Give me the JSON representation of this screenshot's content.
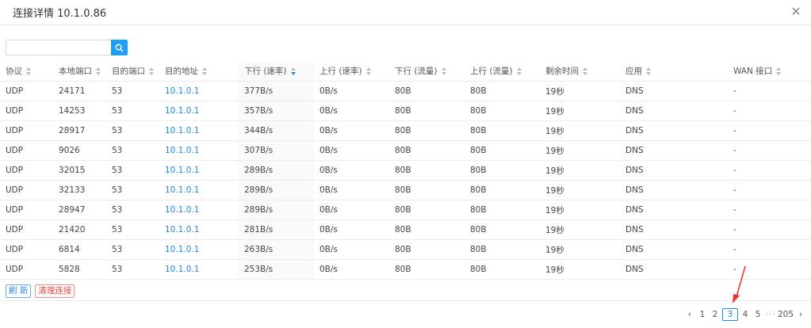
{
  "window": {
    "title": "连接详情 10.1.0.86"
  },
  "search": {
    "placeholder": ""
  },
  "table": {
    "headers": [
      "协议",
      "本地端口",
      "目的端口",
      "目的地址",
      "下行 (速率)",
      "上行 (速率)",
      "下行 (流量)",
      "上行 (流量)",
      "剩余时间",
      "应用",
      "WAN 接口"
    ],
    "rows": [
      [
        "UDP",
        "24171",
        "53",
        "10.1.0.1",
        "377B/s",
        "0B/s",
        "80B",
        "80B",
        "19秒",
        "DNS",
        "-"
      ],
      [
        "UDP",
        "14253",
        "53",
        "10.1.0.1",
        "357B/s",
        "0B/s",
        "80B",
        "80B",
        "19秒",
        "DNS",
        "-"
      ],
      [
        "UDP",
        "28917",
        "53",
        "10.1.0.1",
        "344B/s",
        "0B/s",
        "80B",
        "80B",
        "19秒",
        "DNS",
        "-"
      ],
      [
        "UDP",
        "9026",
        "53",
        "10.1.0.1",
        "307B/s",
        "0B/s",
        "80B",
        "80B",
        "19秒",
        "DNS",
        "-"
      ],
      [
        "UDP",
        "32015",
        "53",
        "10.1.0.1",
        "289B/s",
        "0B/s",
        "80B",
        "80B",
        "19秒",
        "DNS",
        "-"
      ],
      [
        "UDP",
        "32133",
        "53",
        "10.1.0.1",
        "289B/s",
        "0B/s",
        "80B",
        "80B",
        "19秒",
        "DNS",
        "-"
      ],
      [
        "UDP",
        "28947",
        "53",
        "10.1.0.1",
        "289B/s",
        "0B/s",
        "80B",
        "80B",
        "19秒",
        "DNS",
        "-"
      ],
      [
        "UDP",
        "21420",
        "53",
        "10.1.0.1",
        "281B/s",
        "0B/s",
        "80B",
        "80B",
        "19秒",
        "DNS",
        "-"
      ],
      [
        "UDP",
        "6814",
        "53",
        "10.1.0.1",
        "263B/s",
        "0B/s",
        "80B",
        "80B",
        "19秒",
        "DNS",
        "-"
      ],
      [
        "UDP",
        "5828",
        "53",
        "10.1.0.1",
        "253B/s",
        "0B/s",
        "80B",
        "80B",
        "19秒",
        "DNS",
        "-"
      ]
    ]
  },
  "buttons": {
    "refresh": "刷 新",
    "clear": "清理连接"
  },
  "pagination": {
    "prev": "‹",
    "pages": [
      "1",
      "2",
      "3",
      "4",
      "5"
    ],
    "current": "3",
    "ellipsis": "···",
    "last": "205",
    "next": "›"
  },
  "colors": {
    "accent": "#1e88e5",
    "danger": "#e94545",
    "annotation_arrow": "#e53935"
  }
}
